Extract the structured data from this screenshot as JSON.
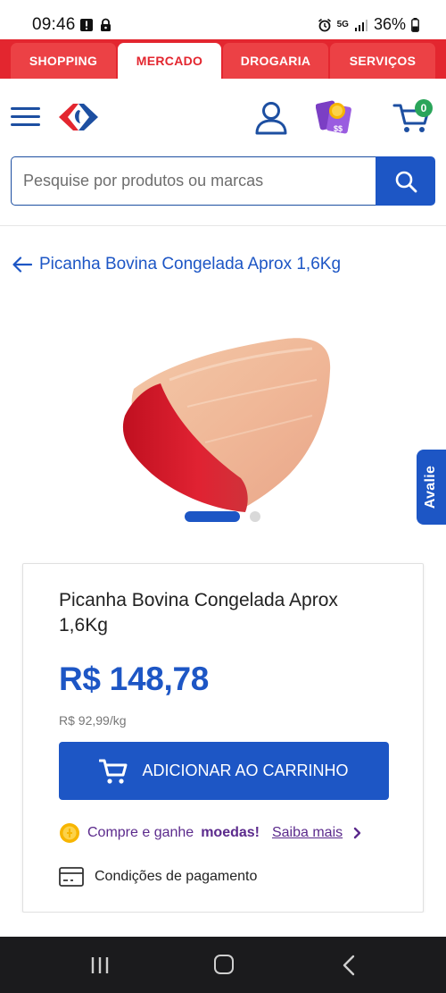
{
  "status_bar": {
    "time": "09:46",
    "network": "5G",
    "battery": "36%"
  },
  "tabs": [
    {
      "label": "SHOPPING",
      "active": false
    },
    {
      "label": "MERCADO",
      "active": true
    },
    {
      "label": "DROGARIA",
      "active": false
    },
    {
      "label": "SERVIÇOS",
      "active": false
    }
  ],
  "header": {
    "cart_count": "0"
  },
  "search": {
    "placeholder": "Pesquise por produtos ou marcas"
  },
  "page": {
    "back_title": "Picanha Bovina Congelada Aprox 1,6Kg"
  },
  "side_tab": {
    "label": "Avalie"
  },
  "product": {
    "title": "Picanha Bovina Congelada Aprox 1,6Kg",
    "price": "R$ 148,78",
    "unit_price": "R$ 92,99/kg",
    "add_to_cart_label": "ADICIONAR AO CARRINHO",
    "coins_prefix": "Compre e ganhe",
    "coins_bold": "moedas!",
    "coins_link": "Saiba mais",
    "payment_label": "Condições de pagamento"
  },
  "colors": {
    "brand_red": "#e3262f",
    "brand_blue": "#1d56c5",
    "coins_purple": "#5b2a8c",
    "badge_green": "#2aa55a"
  }
}
